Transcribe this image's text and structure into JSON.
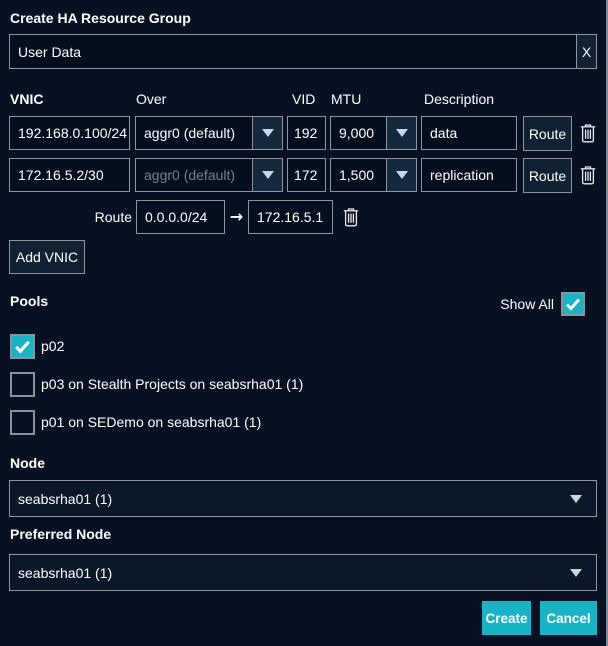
{
  "dialog": {
    "title": "Create HA Resource Group"
  },
  "name_field": {
    "value": "User Data",
    "clear_label": "X"
  },
  "vnic_table": {
    "headers": {
      "vnic": "VNIC",
      "over": "Over",
      "vid": "VID",
      "mtu": "MTU",
      "description": "Description"
    },
    "rows": [
      {
        "vnic": "192.168.0.100/24",
        "over": "aggr0 (default)",
        "vid": "192",
        "mtu": "9,000",
        "description": "data",
        "route_label": "Route",
        "over_disabled": false
      },
      {
        "vnic": "172.16.5.2/30",
        "over": "aggr0 (default)",
        "vid": "172",
        "mtu": "1,500",
        "description": "replication",
        "route_label": "Route",
        "over_disabled": true
      }
    ],
    "route_row": {
      "label": "Route",
      "network": "0.0.0.0/24",
      "arrow": "→",
      "gateway": "172.16.5.1"
    }
  },
  "add_vnic_button": {
    "label": "Add VNIC"
  },
  "pools": {
    "label": "Pools",
    "show_all_label": "Show All",
    "show_all_checked": true,
    "items": [
      {
        "label": "p02",
        "checked": true
      },
      {
        "label": "p03 on Stealth Projects on seabsrha01 (1)",
        "checked": false
      },
      {
        "label": "p01 on SEDemo on seabsrha01 (1)",
        "checked": false
      }
    ]
  },
  "node": {
    "label": "Node",
    "value": "seabsrha01 (1)"
  },
  "preferred_node": {
    "label": "Preferred Node",
    "value": "seabsrha01 (1)"
  },
  "actions": {
    "create_label": "Create",
    "cancel_label": "Cancel"
  },
  "colors": {
    "background": "#071123",
    "accent_teal": "#16b4c6",
    "border": "#8e959c"
  }
}
